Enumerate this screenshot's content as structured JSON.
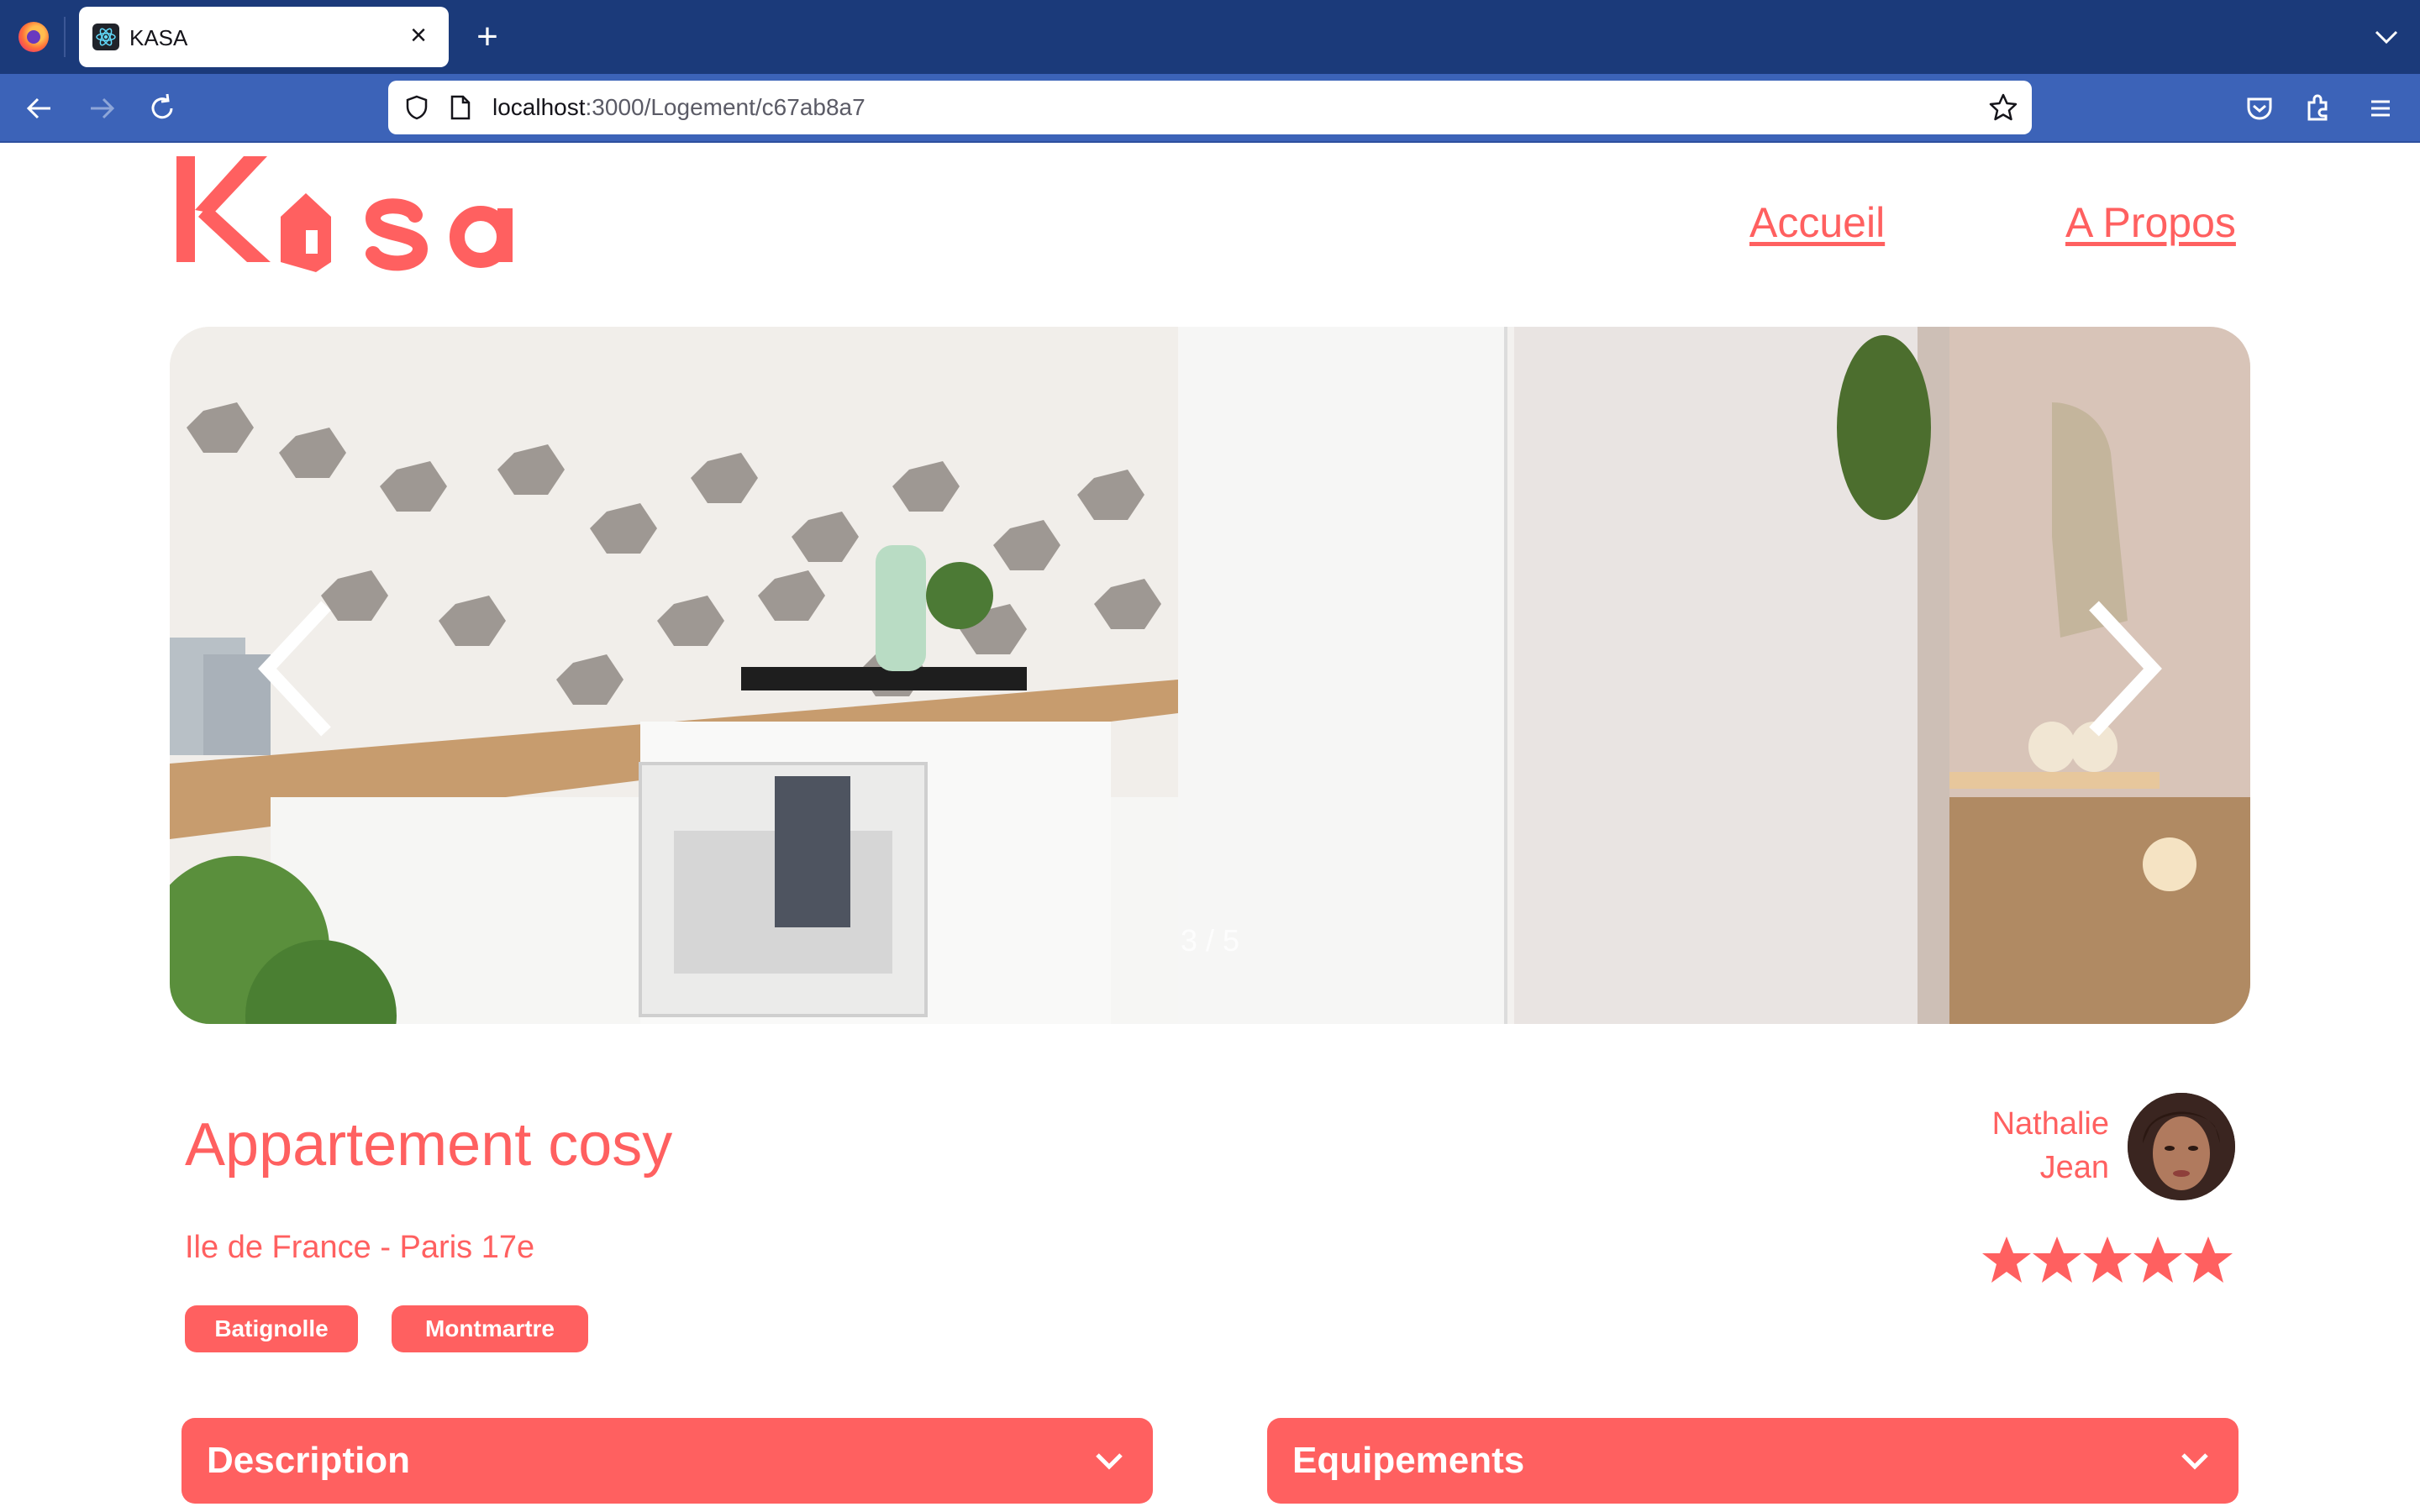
{
  "browser": {
    "tab": {
      "title": "KASA",
      "close_label": "×"
    },
    "new_tab_label": "+",
    "url": {
      "host": "localhost",
      "rest": ":3000/Logement/c67ab8a7"
    }
  },
  "site": {
    "nav": {
      "home": "Accueil",
      "about": "A Propos"
    },
    "logo_text": "Kasa"
  },
  "carousel": {
    "counter": "3 / 5",
    "current_index": 3,
    "total": 5
  },
  "listing": {
    "title": "Appartement cosy",
    "location": "Ile de France - Paris 17e",
    "tags": [
      "Batignolle",
      "Montmartre"
    ],
    "host": {
      "first_name": "Nathalie",
      "last_name": "Jean"
    },
    "rating": 5,
    "rating_max": 5
  },
  "sections": {
    "description": "Description",
    "equipments": "Equipements"
  },
  "colors": {
    "brand": "#ff6060",
    "browser_tabbar": "#1b3a7a",
    "browser_navbar": "#3c63b8"
  }
}
